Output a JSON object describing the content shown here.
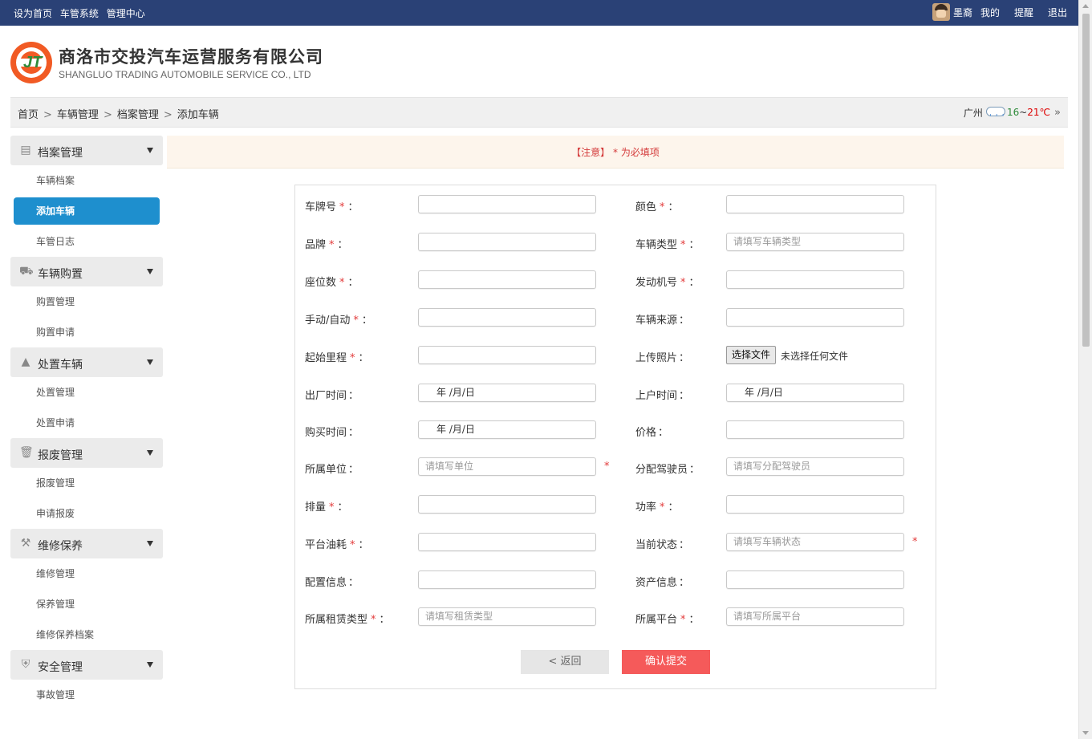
{
  "topbar": {
    "links": [
      "设为首页",
      "车管系统",
      "管理中心"
    ],
    "user": "墨裔",
    "mine": "我的",
    "remind": "提醒",
    "logout": "退出"
  },
  "header": {
    "company_name": "商洛市交投汽车运营服务有限公司",
    "company_en": "SHANGLUO TRADING AUTOMOBILE SERVICE CO., LTD",
    "logo_colors": {
      "ring": "#f15a24",
      "mark": "#2e8b3a"
    }
  },
  "breadcrumb": {
    "items": [
      "首页",
      "车辆管理",
      "档案管理",
      "添加车辆"
    ],
    "separator": ">"
  },
  "weather": {
    "city": "广州",
    "low": "16",
    "tilde": "~",
    "high": "21℃",
    "more": "»"
  },
  "sidebar": {
    "groups": [
      {
        "label": "档案管理",
        "icon": "archive-icon",
        "items": [
          "车辆档案",
          "添加车辆",
          "车管日志"
        ],
        "active": "添加车辆"
      },
      {
        "label": "车辆购置",
        "icon": "cart-icon",
        "items": [
          "购置管理",
          "购置申请"
        ]
      },
      {
        "label": "处置车辆",
        "icon": "cone-icon",
        "items": [
          "处置管理",
          "处置申请"
        ]
      },
      {
        "label": "报废管理",
        "icon": "trash-icon",
        "items": [
          "报废管理",
          "申请报废"
        ]
      },
      {
        "label": "维修保养",
        "icon": "wrench-icon",
        "items": [
          "维修管理",
          "保养管理",
          "维修保养档案"
        ]
      },
      {
        "label": "安全管理",
        "icon": "shield-icon",
        "items": [
          "事故管理"
        ]
      }
    ]
  },
  "notice": {
    "bracket_text": "【注意】",
    "star": "*",
    "text": "为必填项"
  },
  "form": {
    "colon": "：",
    "star": "*",
    "date_placeholder": "年 /月/日",
    "rows": [
      {
        "left": {
          "label": "车牌号",
          "required": true,
          "placeholder": ""
        },
        "right": {
          "label": "颜色",
          "required": true,
          "placeholder": ""
        }
      },
      {
        "left": {
          "label": "品牌",
          "required": true,
          "placeholder": ""
        },
        "right": {
          "label": "车辆类型",
          "required": true,
          "placeholder": "请填写车辆类型"
        }
      },
      {
        "left": {
          "label": "座位数",
          "required": true,
          "placeholder": ""
        },
        "right": {
          "label": "发动机号",
          "required": true,
          "placeholder": ""
        }
      },
      {
        "left": {
          "label": "手动/自动",
          "required": true,
          "placeholder": ""
        },
        "right": {
          "label": "车辆来源",
          "required": false,
          "placeholder": ""
        }
      },
      {
        "left": {
          "label": "起始里程",
          "required": true,
          "placeholder": ""
        },
        "right": {
          "label": "上传照片",
          "required": false,
          "file_button": "选择文件",
          "file_status": "未选择任何文件"
        }
      },
      {
        "left": {
          "label": "出厂时间",
          "required": false,
          "date": true
        },
        "right": {
          "label": "上户时间",
          "required": false,
          "date": true
        }
      },
      {
        "left": {
          "label": "购买时间",
          "required": false,
          "date": true
        },
        "right": {
          "label": "价格",
          "required": false,
          "placeholder": ""
        }
      },
      {
        "left": {
          "label": "所属单位",
          "required": false,
          "placeholder": "请填写单位",
          "trailing_star": true
        },
        "right": {
          "label": "分配驾驶员",
          "required": false,
          "placeholder": "请填写分配驾驶员"
        }
      },
      {
        "left": {
          "label": "排量",
          "required": true,
          "placeholder": ""
        },
        "right": {
          "label": "功率",
          "required": true,
          "placeholder": ""
        }
      },
      {
        "left": {
          "label": "平台油耗",
          "required": true,
          "placeholder": ""
        },
        "right": {
          "label": "当前状态",
          "required": false,
          "placeholder": "请填写车辆状态",
          "trailing_star": true
        }
      },
      {
        "left": {
          "label": "配置信息",
          "required": false,
          "placeholder": ""
        },
        "right": {
          "label": "资产信息",
          "required": false,
          "placeholder": ""
        }
      },
      {
        "left": {
          "label": "所属租赁类型",
          "required": true,
          "placeholder": "请填写租赁类型"
        },
        "right": {
          "label": "所属平台",
          "required": true,
          "placeholder": "请填写所属平台"
        }
      }
    ],
    "back_label": "< 返回",
    "submit_label": "确认提交"
  },
  "colors": {
    "topbar": "#2a4176",
    "active_item": "#1e8fce",
    "submit": "#f55a5a",
    "required_star": "#e23a3a",
    "notice_bg": "#fdf5ec"
  }
}
